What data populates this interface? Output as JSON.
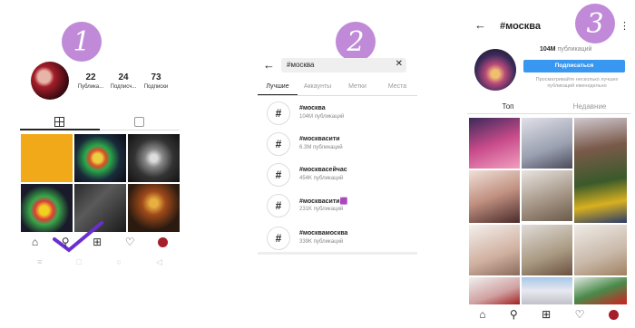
{
  "steps": {
    "one": "1",
    "two": "2",
    "three": "3"
  },
  "profile": {
    "stats": [
      {
        "num": "22",
        "label": "Публика..."
      },
      {
        "num": "24",
        "label": "Подписч..."
      },
      {
        "num": "73",
        "label": "Подписки"
      }
    ],
    "tabs": [
      "grid-icon",
      "tagged-icon"
    ],
    "nav_icons": [
      "home-icon",
      "search-icon",
      "add-post-icon",
      "heart-icon",
      "profile-avatar"
    ]
  },
  "search": {
    "query": "#москва",
    "tabs": [
      "Лучшие",
      "Аккаунты",
      "Метки",
      "Места"
    ],
    "results": [
      {
        "tag": "#москва",
        "count": "104M публикаций"
      },
      {
        "tag": "#москвасити",
        "count": "6.3M публикаций"
      },
      {
        "tag": "#москвасейчас",
        "count": "454K публикаций"
      },
      {
        "tag": "#москвасити🟪",
        "count": "231K публикаций"
      },
      {
        "tag": "#москвамосква",
        "count": "339K публикаций"
      }
    ]
  },
  "hashtag": {
    "title": "#москва",
    "posts_num": "104M",
    "posts_label": "публикаций",
    "subscribe": "Подписаться",
    "note": "Просматривайте несколько лучших публикаций еженедельно",
    "tabs": [
      "Топ",
      "Недавние"
    ]
  },
  "colors": {
    "accent": "#3897f0",
    "step_circle": "#c08ad8",
    "check": "#6a2fd0"
  }
}
